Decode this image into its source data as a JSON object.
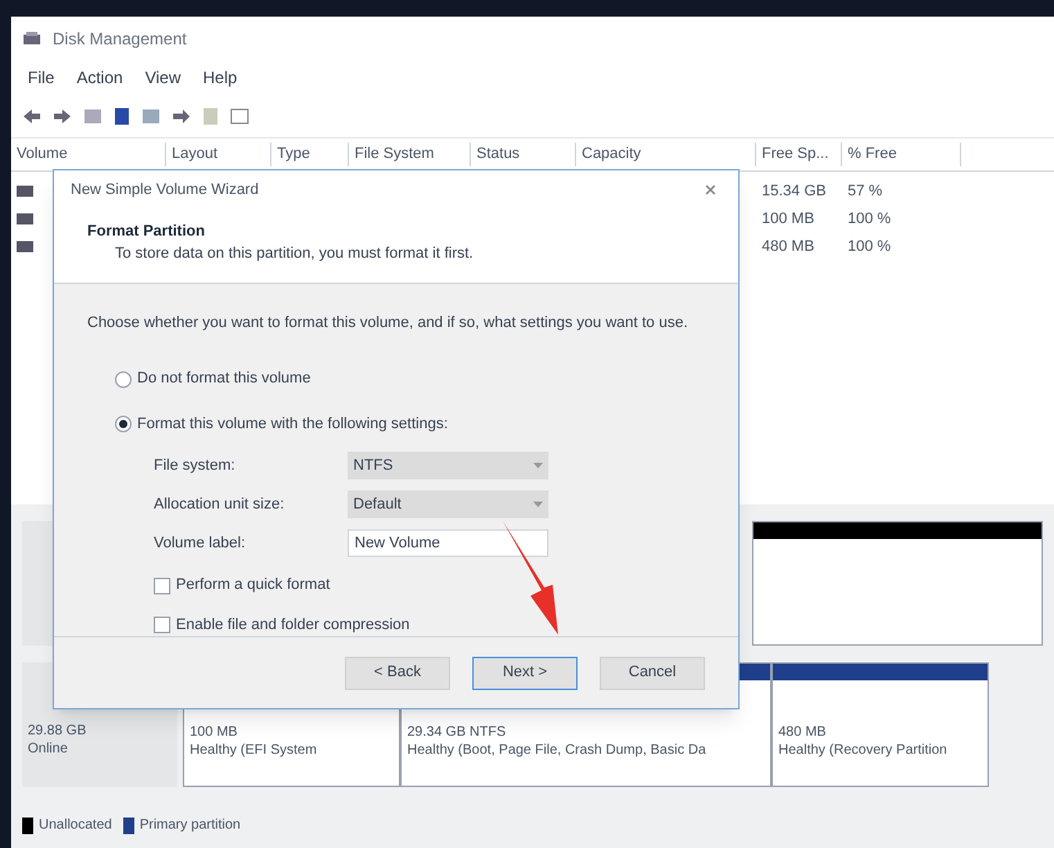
{
  "window": {
    "title": "Disk Management"
  },
  "menu": [
    "File",
    "Action",
    "View",
    "Help"
  ],
  "table": {
    "columns": [
      "Volume",
      "Layout",
      "Type",
      "File System",
      "Status",
      "Capacity",
      "Free Sp...",
      "% Free"
    ],
    "rows": [
      {
        "free": "15.34 GB",
        "percent": "57 %"
      },
      {
        "free": "100 MB",
        "percent": "100 %"
      },
      {
        "free": "480 MB",
        "percent": "100 %"
      }
    ]
  },
  "disks": [
    {
      "partitions": [
        {
          "kind": "unallocated"
        }
      ]
    },
    {
      "label": "29.88 GB",
      "status": "Online",
      "partitions": [
        {
          "kind": "primary",
          "size": "100 MB",
          "status": "Healthy (EFI System"
        },
        {
          "kind": "primary",
          "size": "29.34 GB NTFS",
          "status": "Healthy (Boot, Page File, Crash Dump, Basic Da"
        },
        {
          "kind": "primary",
          "size": "480 MB",
          "status": "Healthy (Recovery Partition"
        }
      ]
    }
  ],
  "legend": [
    {
      "label": "Unallocated",
      "color": "#000000"
    },
    {
      "label": "Primary partition",
      "color": "#1f3f8c"
    }
  ],
  "dialog": {
    "title": "New Simple Volume Wizard",
    "heading": "Format Partition",
    "subheading": "To store data on this partition, you must format it first.",
    "instruction": "Choose whether you want to format this volume, and if so, what settings you want to use.",
    "options": [
      {
        "label": "Do not format this volume",
        "selected": false
      },
      {
        "label": "Format this volume with the following settings:",
        "selected": true
      }
    ],
    "fields": [
      {
        "kind": "select",
        "label": "File system:",
        "value": "NTFS"
      },
      {
        "kind": "select",
        "label": "Allocation unit size:",
        "value": "Default"
      },
      {
        "kind": "text",
        "label": "Volume label:",
        "value": "New Volume"
      }
    ],
    "checkboxes": [
      {
        "label": "Perform a quick format",
        "checked": false
      },
      {
        "label": "Enable file and folder compression",
        "checked": false
      }
    ],
    "buttons": [
      {
        "label": "< Back",
        "default": false
      },
      {
        "label": "Next >",
        "default": true
      },
      {
        "label": "Cancel",
        "default": false
      }
    ]
  }
}
